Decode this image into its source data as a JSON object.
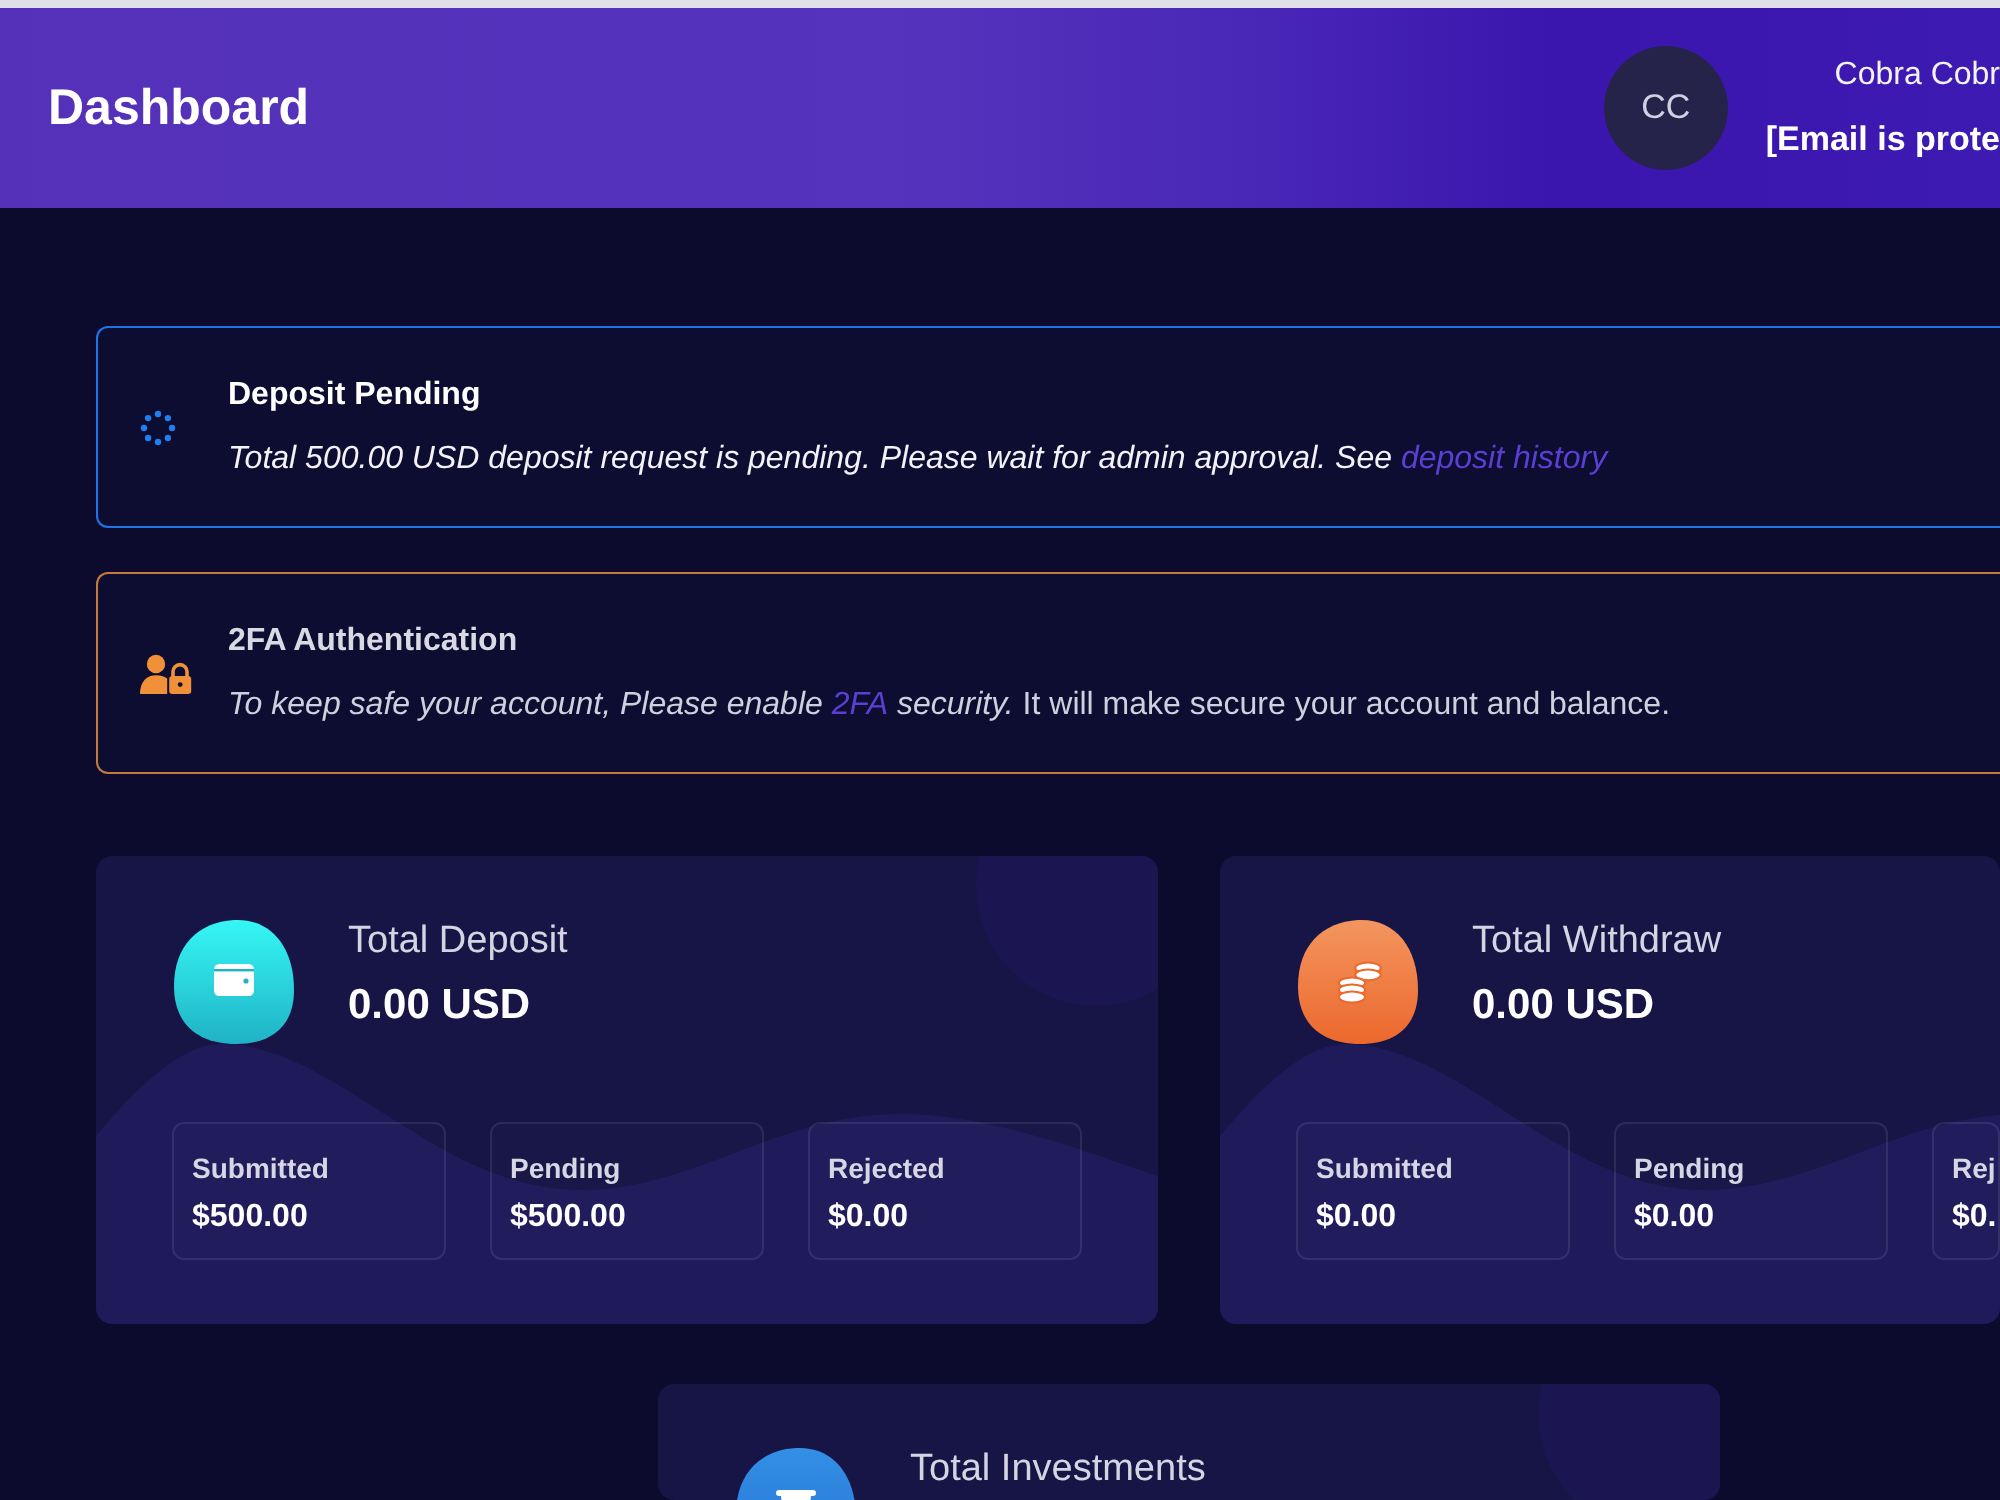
{
  "header": {
    "title": "Dashboard",
    "user": {
      "initials": "CC",
      "name": "Cobra Cobr",
      "email": "[Email is prote"
    }
  },
  "alerts": [
    {
      "kind": "pending",
      "title": "Deposit Pending",
      "message": [
        {
          "kind": "text",
          "text": "Total 500.00 USD deposit request is pending. Please wait for admin approval. See",
          "italic": true
        },
        {
          "kind": "link",
          "text": "deposit history",
          "italic": true
        }
      ]
    },
    {
      "kind": "security",
      "title": "2FA Authentication",
      "message": [
        {
          "kind": "text",
          "text": "To keep safe your account, Please enable",
          "italic": true
        },
        {
          "kind": "link",
          "text": "2FA",
          "italic": true
        },
        {
          "kind": "text",
          "text": "security.",
          "italic": true
        },
        {
          "kind": "text",
          "text": "It will make secure your account and balance.",
          "italic": false
        }
      ]
    }
  ],
  "cards": [
    {
      "kind": "deposit",
      "title": "Total Deposit",
      "amount": "0.00 USD",
      "stats": [
        {
          "label": "Submitted",
          "value": "$500.00"
        },
        {
          "label": "Pending",
          "value": "$500.00"
        },
        {
          "label": "Rejected",
          "value": "$0.00"
        }
      ]
    },
    {
      "kind": "withdraw",
      "title": "Total Withdraw",
      "amount": "0.00 USD",
      "stats": [
        {
          "label": "Submitted",
          "value": "$0.00"
        },
        {
          "label": "Pending",
          "value": "$0.00"
        },
        {
          "label": "Rej",
          "value": "$0."
        }
      ]
    },
    {
      "kind": "investment",
      "title": "Total Investments"
    }
  ]
}
